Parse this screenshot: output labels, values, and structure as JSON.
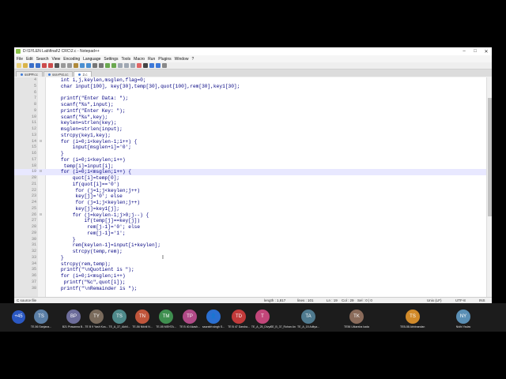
{
  "window": {
    "title": "D:\\SYLEN Lab\\final\\2 CRC\\2.c - Notepad++",
    "controls": [
      "–",
      "□",
      "✕"
    ]
  },
  "menu": [
    "File",
    "Edit",
    "Search",
    "View",
    "Encoding",
    "Language",
    "Settings",
    "Tools",
    "Macro",
    "Run",
    "Plugins",
    "Window",
    "?"
  ],
  "tabs": [
    {
      "label": "ssIPP.cc",
      "active": false
    },
    {
      "label": "sss-Pst.cc",
      "active": false
    },
    {
      "label": "2.c",
      "active": true
    }
  ],
  "colors": {
    "keyword": "#0000ff",
    "code": "#000080",
    "string": "#808080",
    "number": "#ff8000",
    "brace": "#ff0000",
    "current_line": "#e8e8ff"
  },
  "lines": [
    {
      "n": "4",
      "fold": "",
      "text": "    int i,j,keylen,msglen,flag=0;"
    },
    {
      "n": "5",
      "fold": "",
      "text": "    char input[100], key[30],temp[30],quot[100],rem[30],key1[30];"
    },
    {
      "n": "6",
      "fold": "",
      "text": ""
    },
    {
      "n": "7",
      "fold": "",
      "text": "    printf(\"Enter Data: \");"
    },
    {
      "n": "8",
      "fold": "",
      "text": "    scanf(\"%s\",input);"
    },
    {
      "n": "9",
      "fold": "",
      "text": "    printf(\"Enter Key: \");"
    },
    {
      "n": "10",
      "fold": "",
      "text": "    scanf(\"%s\",key);"
    },
    {
      "n": "11",
      "fold": "",
      "text": "    keylen=strlen(key);"
    },
    {
      "n": "12",
      "fold": "",
      "text": "    msglen=strlen(input);"
    },
    {
      "n": "13",
      "fold": "",
      "text": "    strcpy(key1,key);"
    },
    {
      "n": "14",
      "fold": "⊟",
      "text": "    for (i=0;i<keylen-1;i++) {"
    },
    {
      "n": "15",
      "fold": "",
      "text": "        input[msglen+i]='0';"
    },
    {
      "n": "16",
      "fold": "",
      "text": "    }"
    },
    {
      "n": "17",
      "fold": "",
      "text": "    for (i=0;i<keylen;i++)"
    },
    {
      "n": "18",
      "fold": "",
      "text": "     temp[i]=input[i];"
    },
    {
      "n": "19",
      "fold": "⊟",
      "text": "    for (i=0;i<msglen;i++) {",
      "current": true
    },
    {
      "n": "20",
      "fold": "",
      "text": "        quot[i]=temp[0];"
    },
    {
      "n": "21",
      "fold": "",
      "text": "        if(quot[i]=='0')"
    },
    {
      "n": "22",
      "fold": "",
      "text": "         for (j=1;j<keylen;j++)"
    },
    {
      "n": "23",
      "fold": "",
      "text": "         key[j]='0'; else"
    },
    {
      "n": "24",
      "fold": "",
      "text": "         for (j=1;j<keylen;j++)"
    },
    {
      "n": "25",
      "fold": "",
      "text": "         key[j]=key1[j];"
    },
    {
      "n": "26",
      "fold": "⊟",
      "text": "        for (j=keylen-1;j>0;j--) {"
    },
    {
      "n": "27",
      "fold": "",
      "text": "            if(temp[j]==key[j])"
    },
    {
      "n": "28",
      "fold": "",
      "text": "             rem[j-1]='0'; else"
    },
    {
      "n": "29",
      "fold": "",
      "text": "             rem[j-1]='1';"
    },
    {
      "n": "30",
      "fold": "",
      "text": "        }"
    },
    {
      "n": "31",
      "fold": "",
      "text": "        rem[keylen-1]=input[i+keylen];"
    },
    {
      "n": "32",
      "fold": "",
      "text": "        strcpy(temp,rem);"
    },
    {
      "n": "33",
      "fold": "",
      "text": "    }"
    },
    {
      "n": "34",
      "fold": "",
      "text": "    strcpy(rem,temp);"
    },
    {
      "n": "35",
      "fold": "",
      "text": "    printf(\"\\nQuotient is \");"
    },
    {
      "n": "36",
      "fold": "",
      "text": "    for (i=0;i<msglen;i++)"
    },
    {
      "n": "37",
      "fold": "",
      "text": "     printf(\"%c\",quot[i]);"
    },
    {
      "n": "38",
      "fold": "",
      "text": "    printf(\"\\nRemainder is \");"
    }
  ],
  "status": {
    "type": "C source file",
    "length": "length : 1,817",
    "lines": "lines : 101",
    "ln": "Ln : 19",
    "col": "Col : 29",
    "sel": "Sel : 0 | 0",
    "eol": "Unix (LF)",
    "encoding": "UTF-8",
    "mode": "INS"
  },
  "participants": {
    "count_label": "+45",
    "people": [
      {
        "initials": "TS",
        "name": "TE-56 Sanjana...",
        "color": "#5b7fa6"
      },
      {
        "initials": "BP",
        "name": "B21 Prasanna B...",
        "color": "#6d6d9b"
      },
      {
        "initials": "TY",
        "name": "TE B 9 Yash Kus...",
        "color": "#7a6b5c"
      },
      {
        "initials": "TS",
        "name": "TE_A_37_Akhil...",
        "color": "#4f8a8b"
      },
      {
        "initials": "TN",
        "name": "TE-56 Nikhil N...",
        "color": "#c0553b"
      },
      {
        "initials": "TM",
        "name": "TE-55 MEHTA...",
        "color": "#3f8f4f"
      },
      {
        "initials": "TP",
        "name": "TE B 40 Akash...",
        "color": "#b14a87"
      },
      {
        "initials": "👤",
        "name": "saurabh singh S...",
        "color": "#2a6fd1"
      },
      {
        "initials": "TD",
        "name": "TE B 47 Darsha...",
        "color": "#c23a3a"
      },
      {
        "initials": "T",
        "name": "TE_A_25_Divya...",
        "color": "#c2467a"
      },
      {
        "initials": "",
        "name": "TE_B_37_Rohan Arora (Guest)",
        "color": ""
      },
      {
        "initials": "TA",
        "name": "TE_A_15 Aditya...",
        "color": "#4f7a8f"
      },
      {
        "initials": "TK",
        "name": "TE56 Utkarsha kadam",
        "color": "#8a6b5a"
      },
      {
        "initials": "TS",
        "name": "TEB-58 Abhinandan Shelke",
        "color": "#d18a2a"
      },
      {
        "initials": "NY",
        "name": "Nidhi Yadav",
        "color": "#5a8fb5"
      }
    ]
  }
}
